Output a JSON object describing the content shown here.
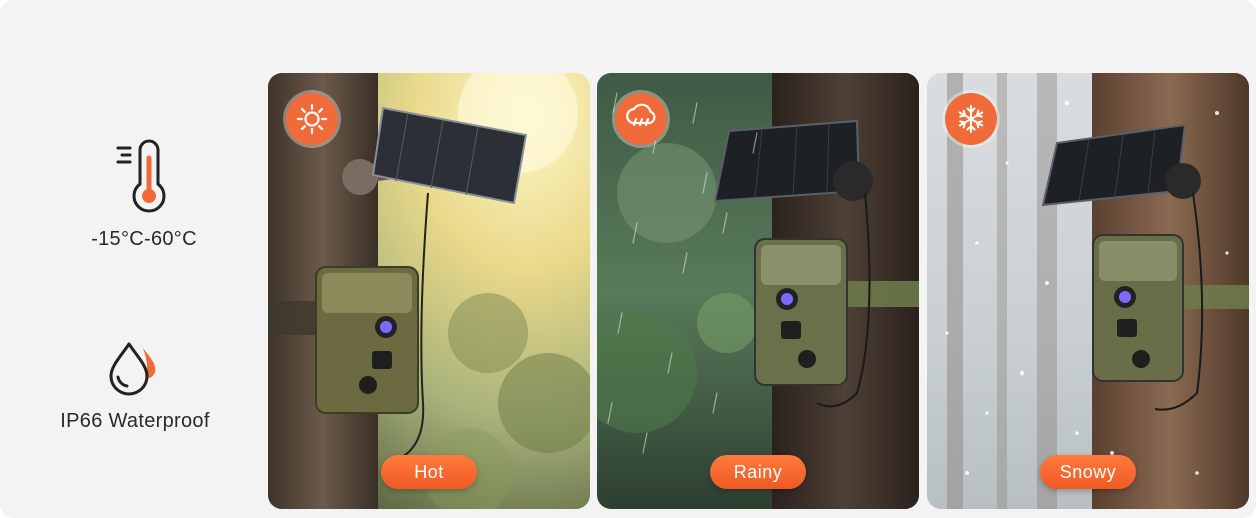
{
  "features": [
    {
      "label": "-15°C-60°C",
      "icon": "thermometer-icon"
    },
    {
      "label": "IP66 Waterproof",
      "icon": "water-drop-icon"
    }
  ],
  "panels": [
    {
      "label": "Hot",
      "icon": "sun-icon"
    },
    {
      "label": "Rainy",
      "icon": "rain-cloud-icon"
    },
    {
      "label": "Snowy",
      "icon": "snowflake-icon"
    }
  ],
  "colors": {
    "accent": "#f06a3a",
    "background": "#f3f3f3",
    "text": "#2a2a2a"
  }
}
